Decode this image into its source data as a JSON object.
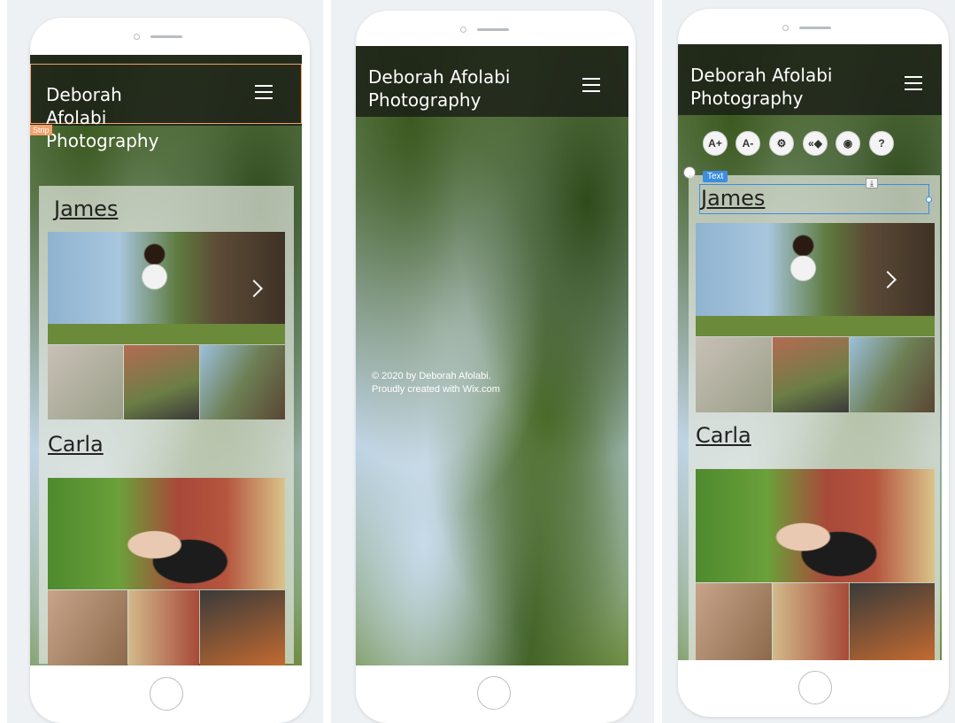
{
  "site": {
    "title_line1": "Deborah",
    "title_line2": "Afolabi",
    "title_line3": "Photography",
    "title_full_line1": "Deborah Afolabi",
    "title_full_line2": "Photography"
  },
  "editor": {
    "strip_tag": "Strip",
    "text_tag": "Text",
    "toolbar": {
      "font_up": "A+",
      "font_down": "A-",
      "settings_icon": "gear-icon",
      "animation_icon": "animation-icon",
      "hide_icon": "eye-off-icon",
      "help_icon": "help-icon"
    }
  },
  "gallery": {
    "james_heading": "James",
    "carla_heading": "Carla"
  },
  "footer": {
    "line1": "© 2020 by Deborah Afolabi.",
    "line2": "Proudly created with Wix.com"
  }
}
